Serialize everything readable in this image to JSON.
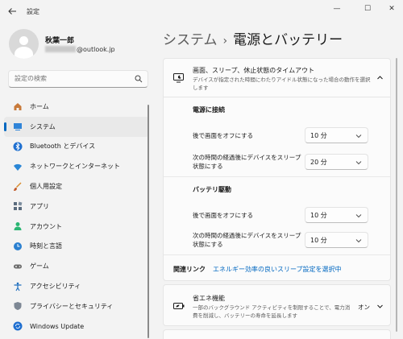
{
  "window": {
    "title": "設定",
    "minimize": "—",
    "maximize": "☐",
    "close": "✕"
  },
  "profile": {
    "name": "秋葉一郎",
    "email_suffix": "@outlook.jp"
  },
  "search": {
    "placeholder": "設定の検索"
  },
  "sidebar": {
    "items": [
      {
        "label": "ホーム",
        "icon": "home-icon",
        "active": false
      },
      {
        "label": "システム",
        "icon": "system-icon",
        "active": true
      },
      {
        "label": "Bluetooth とデバイス",
        "icon": "bluetooth-icon",
        "active": false
      },
      {
        "label": "ネットワークとインターネット",
        "icon": "wifi-icon",
        "active": false
      },
      {
        "label": "個人用設定",
        "icon": "brush-icon",
        "active": false
      },
      {
        "label": "アプリ",
        "icon": "apps-icon",
        "active": false
      },
      {
        "label": "アカウント",
        "icon": "account-icon",
        "active": false
      },
      {
        "label": "時刻と言語",
        "icon": "clock-globe-icon",
        "active": false
      },
      {
        "label": "ゲーム",
        "icon": "gamepad-icon",
        "active": false
      },
      {
        "label": "アクセシビリティ",
        "icon": "accessibility-icon",
        "active": false
      },
      {
        "label": "プライバシーとセキュリティ",
        "icon": "shield-icon",
        "active": false
      },
      {
        "label": "Windows Update",
        "icon": "update-icon",
        "active": false
      }
    ]
  },
  "header": {
    "breadcrumb_parent": "システム",
    "separator": "›",
    "page_title": "電源とバッテリー"
  },
  "sleep_card": {
    "title": "画面、スリープ、休止状態のタイムアウト",
    "description": "デバイスが指定された時間にわたりアイドル状態になった場合の動作を選択します",
    "plugged_in": {
      "heading": "電源に接続",
      "screen_off_label": "後で画面をオフにする",
      "screen_off_value": "10 分",
      "sleep_label": "次の時間の経過後にデバイスをスリープ状態にする",
      "sleep_value": "20 分"
    },
    "battery": {
      "heading": "バッテリ駆動",
      "screen_off_label": "後で画面をオフにする",
      "screen_off_value": "10 分",
      "sleep_label": "次の時間の経過後にデバイスをスリープ状態にする",
      "sleep_value": "10 分"
    },
    "related_label": "関連リンク",
    "related_link": "エネルギー効率の良いスリープ設定を選択中"
  },
  "saver_card": {
    "title": "省エネ機能",
    "description": "一部のバックグラウンド アクティビティを制限することで、電力消費を削減し、バッテリーの寿命を延長します",
    "status": "オン"
  },
  "colors": {
    "accent": "#0067c0",
    "background": "#f3f3f3",
    "card": "#fbfbfb"
  }
}
